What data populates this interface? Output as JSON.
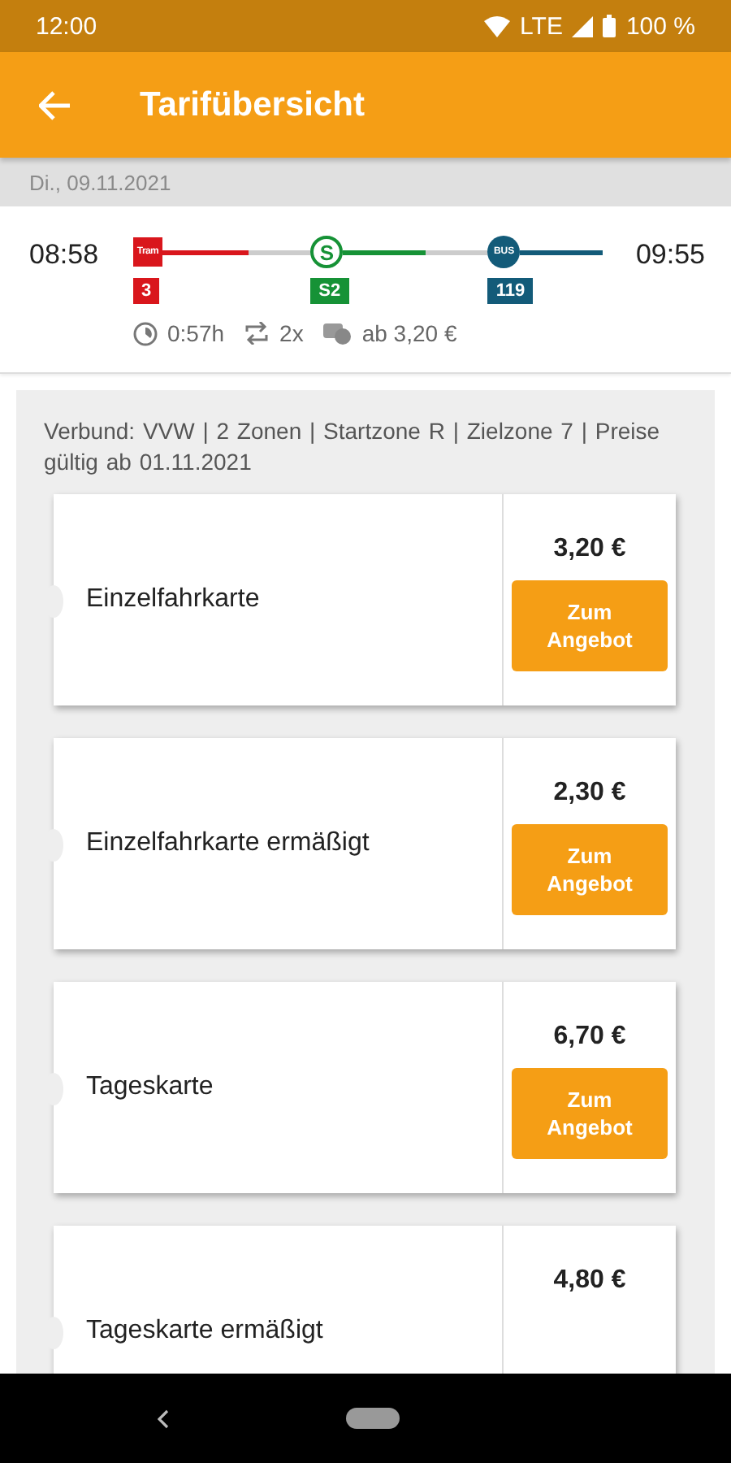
{
  "status_bar": {
    "time": "12:00",
    "network": "LTE",
    "battery": "100 %"
  },
  "app_bar": {
    "title": "Tarifübersicht"
  },
  "date": "Di., 09.11.2021",
  "journey": {
    "departure": "08:58",
    "arrival": "09:55",
    "legs": [
      {
        "kind": "tram",
        "icon_text": "Tram",
        "line": "3",
        "color": "#d9161c"
      },
      {
        "kind": "sbahn",
        "icon_text": "S",
        "line": "S2",
        "color": "#169236"
      },
      {
        "kind": "bus",
        "icon_text": "BUS",
        "line": "119",
        "color": "#135b79"
      }
    ],
    "duration": "0:57h",
    "transfers": "2x",
    "price_from": "ab 3,20 €"
  },
  "tariff_info": "Verbund: VVW |  2 Zonen |  Startzone R |  Zielzone 7 |  Preise gültig ab 01.11.2021",
  "tickets": [
    {
      "name": "Einzelfahrkarte",
      "price": "3,20 €",
      "button": "Zum Angebot"
    },
    {
      "name": "Einzelfahrkarte ermäßigt",
      "price": "2,30 €",
      "button": "Zum Angebot"
    },
    {
      "name": "Tageskarte",
      "price": "6,70 €",
      "button": "Zum Angebot"
    },
    {
      "name": "Tageskarte ermäßigt",
      "price": "4,80 €"
    }
  ]
}
